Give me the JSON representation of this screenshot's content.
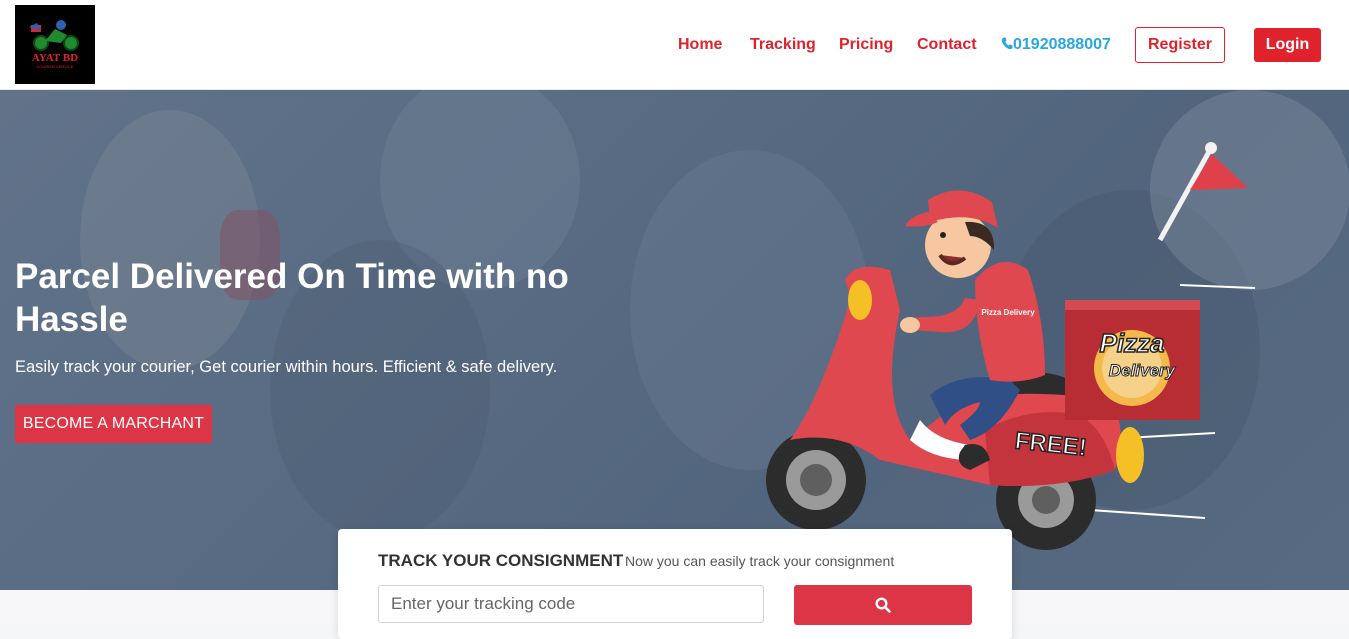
{
  "header": {
    "logo_text": "AYAT BD",
    "logo_tagline": "COURIER SERVICE",
    "nav": {
      "home": "Home",
      "tracking": "Tracking",
      "pricing": "Pricing",
      "contact": "Contact",
      "phone": "01920888007",
      "phone_icon": "phone-icon"
    },
    "register": "Register",
    "login": "Login"
  },
  "hero": {
    "title": "Parcel Delivered On Time with no Hassle",
    "subtitle": "Easily track your courier, Get courier within hours. Efficient & safe delivery.",
    "cta": "BECOME A MARCHANT",
    "illustration": {
      "box_text_1": "Pizza",
      "box_text_2": "Delivery",
      "badge": "FREE!",
      "shirt": "Pizza Delivery"
    }
  },
  "track": {
    "title": "TRACK YOUR CONSIGNMENT",
    "subtitle": "Now you can easily track your consignment",
    "placeholder": "Enter your tracking code",
    "button_icon": "search-icon"
  },
  "colors": {
    "accent": "#e0222d",
    "button_red": "#dc3545",
    "phone_blue": "#29a8e0"
  }
}
